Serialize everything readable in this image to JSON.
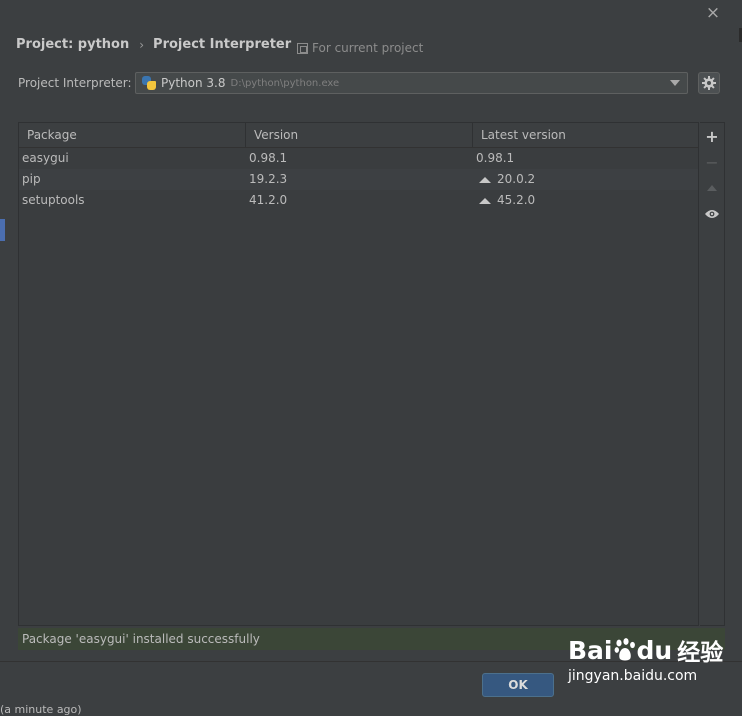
{
  "breadcrumb": {
    "project": "Project: python",
    "separator": "›",
    "page": "Project Interpreter"
  },
  "scope": {
    "label": "For current project"
  },
  "interpreter": {
    "label": "Project Interpreter:",
    "name": "Python 3.8",
    "path": "D:\\python\\python.exe"
  },
  "table": {
    "headers": [
      "Package",
      "Version",
      "Latest version"
    ],
    "rows": [
      {
        "package": "easygui",
        "version": "0.98.1",
        "latest": "0.98.1",
        "upgrade": false
      },
      {
        "package": "pip",
        "version": "19.2.3",
        "latest": "20.0.2",
        "upgrade": true
      },
      {
        "package": "setuptools",
        "version": "41.2.0",
        "latest": "45.2.0",
        "upgrade": true
      }
    ]
  },
  "tools": {
    "add": "+",
    "remove": "−"
  },
  "status": {
    "message": "Package 'easygui' installed successfully"
  },
  "buttons": {
    "ok": "OK",
    "close": "×"
  },
  "footer": {
    "text": "(a minute ago)"
  },
  "watermark": {
    "brand": "Bai",
    "brand2": "du",
    "cn": "经验",
    "url": "jingyan.baidu.com"
  },
  "icons": [
    "close-icon",
    "copy-icon",
    "python-icon",
    "chevron-down-icon",
    "gear-icon",
    "plus-icon",
    "minus-icon",
    "upgrade-icon",
    "eye-icon",
    "upgrade-arrow-icon"
  ],
  "colors": {
    "background": "#3c3f41",
    "status_bg": "#3b4637",
    "accent": "#365880",
    "python_blue": "#3a75b0",
    "python_yellow": "#f2c53d"
  }
}
